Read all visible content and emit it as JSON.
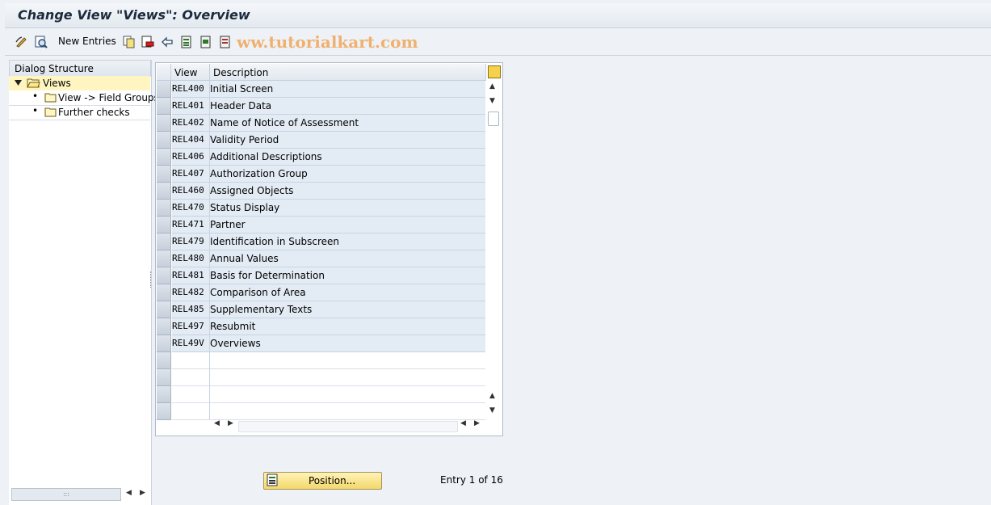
{
  "window": {
    "title": "Change View \"Views\": Overview"
  },
  "toolbar": {
    "new_entries_label": "New Entries",
    "watermark": "ww.tutorialkart.com",
    "icons": [
      "display-change-icon",
      "details-icon",
      "copy-icon",
      "delete-icon",
      "undo-icon",
      "select-all-icon",
      "select-block-icon",
      "deselect-all-icon"
    ]
  },
  "dialog_structure": {
    "header": "Dialog Structure",
    "items": [
      {
        "label": "Views",
        "level": 0,
        "expanded": true,
        "selected": true
      },
      {
        "label": "View -> Field Groups",
        "level": 1
      },
      {
        "label": "Further checks",
        "level": 1
      }
    ]
  },
  "table": {
    "columns": [
      "View",
      "Description"
    ],
    "rows": [
      {
        "view": "REL400",
        "description": "Initial Screen"
      },
      {
        "view": "REL401",
        "description": "Header Data"
      },
      {
        "view": "REL402",
        "description": "Name of Notice of Assessment"
      },
      {
        "view": "REL404",
        "description": "Validity Period"
      },
      {
        "view": "REL406",
        "description": "Additional Descriptions"
      },
      {
        "view": "REL407",
        "description": "Authorization Group"
      },
      {
        "view": "REL460",
        "description": "Assigned Objects"
      },
      {
        "view": "REL470",
        "description": "Status Display"
      },
      {
        "view": "REL471",
        "description": "Partner"
      },
      {
        "view": "REL479",
        "description": "Identification in Subscreen"
      },
      {
        "view": "REL480",
        "description": "Annual Values"
      },
      {
        "view": "REL481",
        "description": "Basis for Determination"
      },
      {
        "view": "REL482",
        "description": "Comparison of Area"
      },
      {
        "view": "REL485",
        "description": "Supplementary Texts"
      },
      {
        "view": "REL497",
        "description": "Resubmit"
      },
      {
        "view": "REL49V",
        "description": "Overviews"
      }
    ],
    "empty_rows": 4
  },
  "footer": {
    "position_label": "Position...",
    "entry_text": "Entry 1 of 16"
  },
  "colors": {
    "row_bg": "#e3ecf4",
    "selected_tree_bg": "#fff5c0",
    "button_bg": "#f3d86a"
  }
}
